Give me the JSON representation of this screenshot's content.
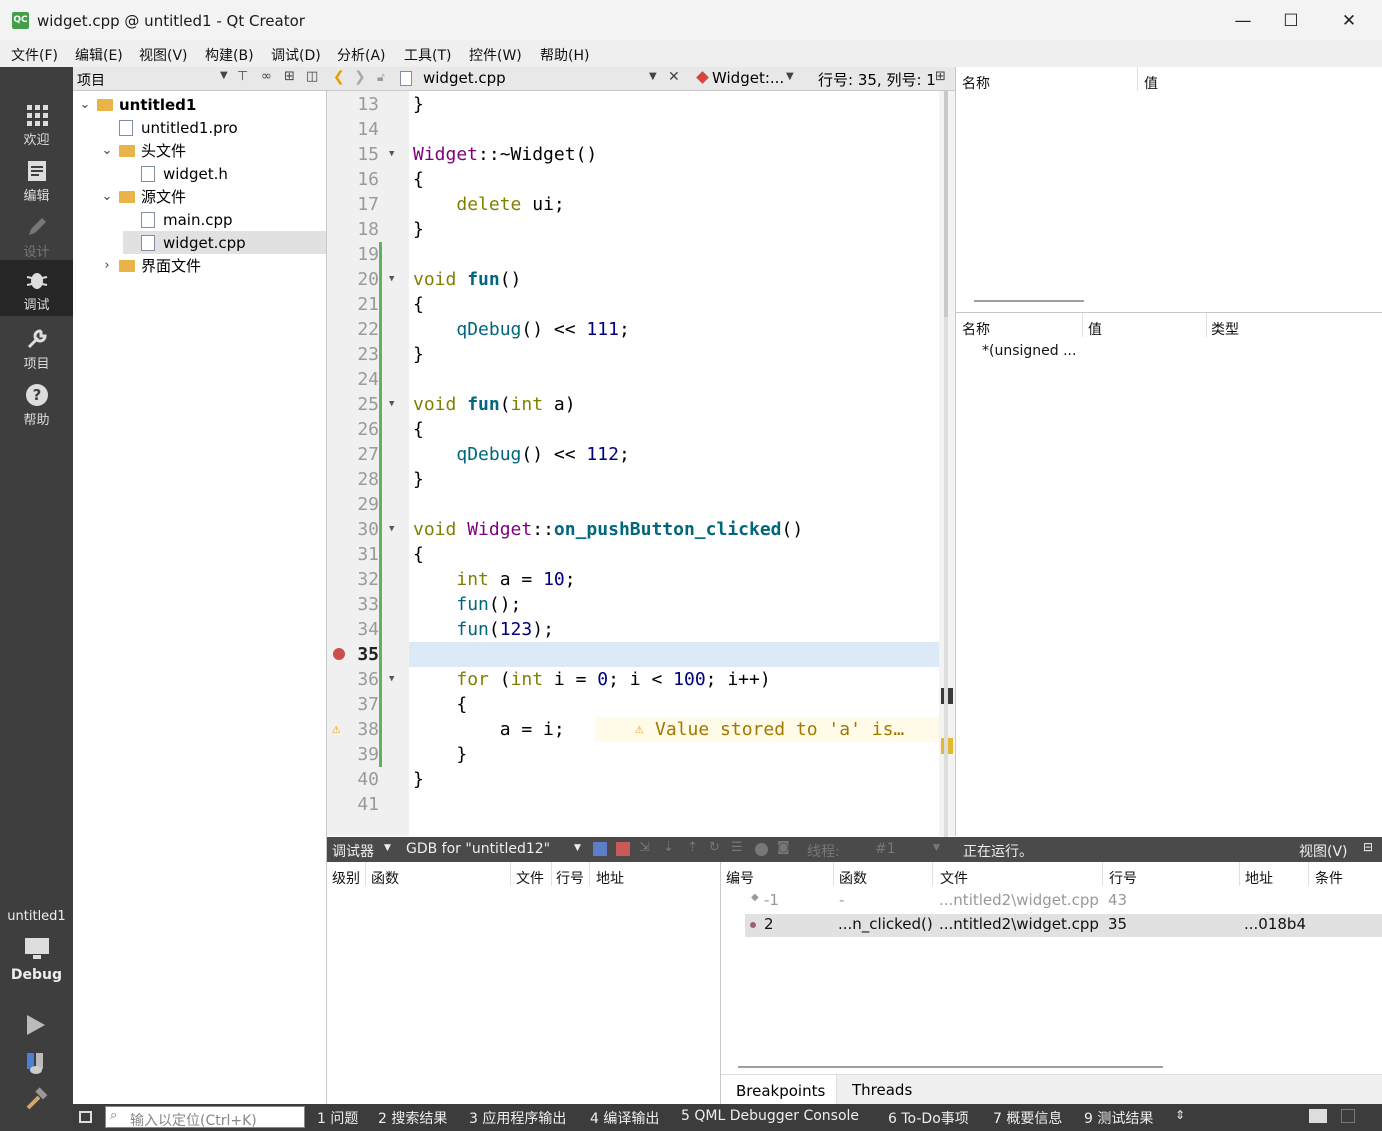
{
  "window": {
    "title": "widget.cpp @ untitled1 - Qt Creator",
    "app_icon": "QC",
    "minimize": "—",
    "maximize": "☐",
    "close": "✕"
  },
  "menu": [
    "文件(F)",
    "编辑(E)",
    "视图(V)",
    "构建(B)",
    "调试(D)",
    "分析(A)",
    "工具(T)",
    "控件(W)",
    "帮助(H)"
  ],
  "modes": [
    {
      "label": "欢迎",
      "icon": "grid-icon"
    },
    {
      "label": "编辑",
      "icon": "edit-icon"
    },
    {
      "label": "设计",
      "icon": "pencil-icon"
    },
    {
      "label": "调试",
      "icon": "bug-icon"
    },
    {
      "label": "项目",
      "icon": "wrench-icon"
    },
    {
      "label": "帮助",
      "icon": "help-icon"
    }
  ],
  "target": {
    "project": "untitled1",
    "config": "Debug"
  },
  "project_pane": {
    "title": "项目",
    "tree": [
      {
        "label": "untitled1",
        "level": 0,
        "kind": "project",
        "expanded": true,
        "bold": true
      },
      {
        "label": "untitled1.pro",
        "level": 1,
        "kind": "file"
      },
      {
        "label": "头文件",
        "level": 1,
        "kind": "folder",
        "expanded": true
      },
      {
        "label": "widget.h",
        "level": 2,
        "kind": "file"
      },
      {
        "label": "源文件",
        "level": 1,
        "kind": "folder",
        "expanded": true
      },
      {
        "label": "main.cpp",
        "level": 2,
        "kind": "file"
      },
      {
        "label": "widget.cpp",
        "level": 2,
        "kind": "file",
        "selected": true
      },
      {
        "label": "界面文件",
        "level": 1,
        "kind": "folder",
        "expanded": false
      }
    ]
  },
  "editor": {
    "file_name": "widget.cpp",
    "symbol": "Widget:...",
    "position": "行号: 35, 列号: 1",
    "current_line": 35,
    "breakpoint_line": 35,
    "warning_line": 38,
    "warning_text": "Value stored to 'a' is…",
    "lines": [
      {
        "n": "13",
        "code": "}"
      },
      {
        "n": "14",
        "code": ""
      },
      {
        "n": "15",
        "code": "Widget::~Widget()"
      },
      {
        "n": "16",
        "code": "{"
      },
      {
        "n": "17",
        "code": "    delete ui;"
      },
      {
        "n": "18",
        "code": "}"
      },
      {
        "n": "19",
        "code": ""
      },
      {
        "n": "20",
        "code": "void fun()"
      },
      {
        "n": "21",
        "code": "{"
      },
      {
        "n": "22",
        "code": "    qDebug() << 111;"
      },
      {
        "n": "23",
        "code": "}"
      },
      {
        "n": "24",
        "code": ""
      },
      {
        "n": "25",
        "code": "void fun(int a)"
      },
      {
        "n": "26",
        "code": "{"
      },
      {
        "n": "27",
        "code": "    qDebug() << 112;"
      },
      {
        "n": "28",
        "code": "}"
      },
      {
        "n": "29",
        "code": ""
      },
      {
        "n": "30",
        "code": "void Widget::on_pushButton_clicked()"
      },
      {
        "n": "31",
        "code": "{"
      },
      {
        "n": "32",
        "code": "    int a = 10;"
      },
      {
        "n": "33",
        "code": "    fun();"
      },
      {
        "n": "34",
        "code": "    fun(123);"
      },
      {
        "n": "35",
        "code": ""
      },
      {
        "n": "36",
        "code": "    for (int i = 0; i < 100; i++)"
      },
      {
        "n": "37",
        "code": "    {"
      },
      {
        "n": "38",
        "code": "        a = i;"
      },
      {
        "n": "39",
        "code": "    }"
      },
      {
        "n": "40",
        "code": "}"
      },
      {
        "n": "41",
        "code": ""
      }
    ]
  },
  "watch_top": {
    "col_name": "名称",
    "col_value": "值"
  },
  "locals": {
    "col_name": "名称",
    "col_value": "值",
    "col_type": "类型",
    "rows": [
      {
        "name": "*(unsigned ..."
      }
    ]
  },
  "debugger_bar": {
    "label": "调试器",
    "engine": "GDB for \"untitled12\"",
    "threads_label": "线程:",
    "thread": "#1",
    "status": "正在运行。",
    "view": "视图(V)"
  },
  "stack": {
    "cols": [
      "级别",
      "函数",
      "文件",
      "行号",
      "地址"
    ]
  },
  "breakpoints": {
    "cols": [
      "编号",
      "函数",
      "文件",
      "行号",
      "地址",
      "条件"
    ],
    "rows": [
      {
        "id": "-1",
        "func": "-",
        "file": "...ntitled2\\widget.cpp",
        "line": "43",
        "addr": "",
        "dim": true
      },
      {
        "id": "2",
        "func": "...n_clicked()",
        "file": "...ntitled2\\widget.cpp",
        "line": "35",
        "addr": "...018b4",
        "dim": false
      }
    ],
    "tabs": [
      "Breakpoints",
      "Threads"
    ]
  },
  "statusbar": {
    "locator_placeholder": "输入以定位(Ctrl+K)",
    "panes": [
      "1 问题",
      "2 搜索结果",
      "3 应用程序输出",
      "4 编译输出",
      "5 QML Debugger Console",
      "6 To-Do事项",
      "7 概要信息",
      "9 测试结果"
    ]
  },
  "colors": {
    "current_line": "#dce9f7",
    "breakpoint": "#c9504b",
    "warning": "#e6a200",
    "selected_row": "#e1e1e1"
  }
}
